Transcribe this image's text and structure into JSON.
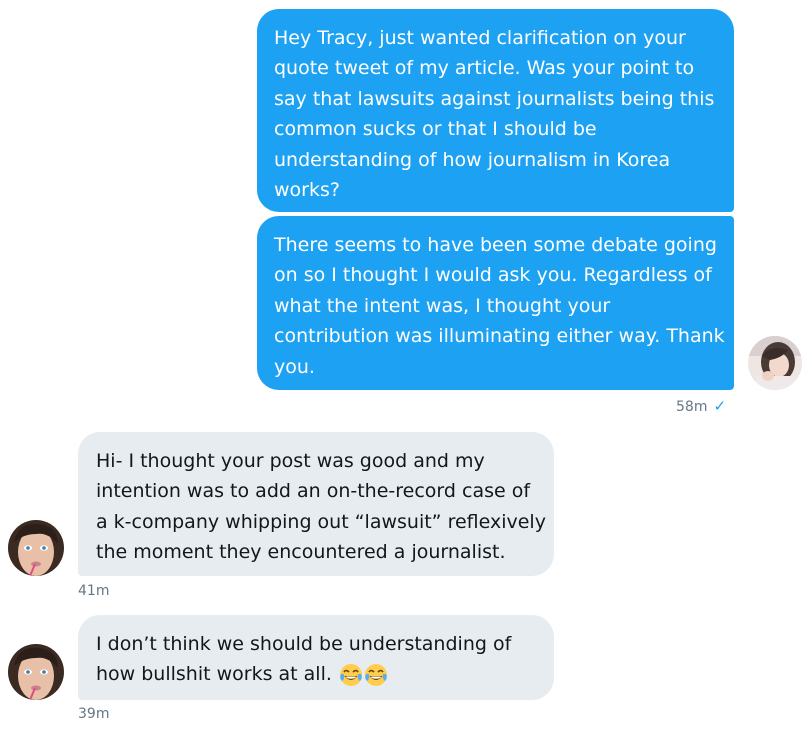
{
  "messages": [
    {
      "id": "m1",
      "sender": "me",
      "lines": [
        "Hey Tracy, just wanted clarification on your",
        "quote tweet of my article. Was your point to",
        "say that lawsuits against journalists being this",
        "common sucks or that I should be",
        "understanding of how journalism in Korea",
        "works?"
      ]
    },
    {
      "id": "m2",
      "sender": "me",
      "lines": [
        "There seems to have been some debate going",
        "on so I thought I would ask you. Regardless of",
        "what the intent was, I thought your",
        "contribution was illuminating either way. Thank",
        "you."
      ],
      "timestamp": "58m",
      "read_icon": "checkmark-icon"
    },
    {
      "id": "m3",
      "sender": "them",
      "lines": [
        "Hi- I thought your post was good and my",
        "intention was to add an on-the-record case of",
        "a k-company whipping out “lawsuit” reflexively",
        "the moment they encountered a journalist."
      ],
      "timestamp": "41m"
    },
    {
      "id": "m4",
      "sender": "them",
      "lines": [
        "I don’t think we should be understanding of",
        "how bullshit works at all."
      ],
      "emoji": [
        "face-with-tears-of-joy",
        "face-with-tears-of-joy"
      ],
      "timestamp": "39m"
    }
  ],
  "colors": {
    "outgoing_bubble": "#1da1f2",
    "incoming_bubble": "#e6ecf0",
    "timestamp": "#657786",
    "check": "#1da1f2"
  }
}
